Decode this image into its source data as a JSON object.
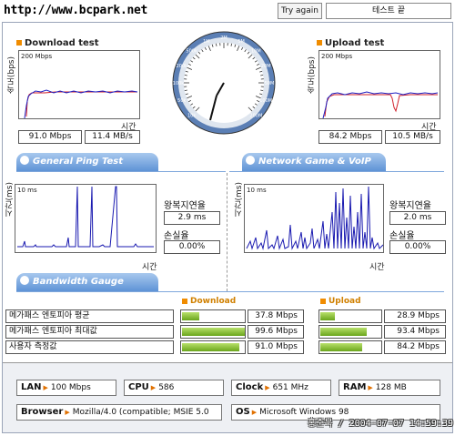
{
  "site": "http://www.bcpark.net",
  "top": {
    "try_again": "Try again",
    "status": "테스트 끝"
  },
  "download": {
    "title": "Download test",
    "ylabel": "속도(bps)",
    "tick": "200 Mbps",
    "xlabel": "시간",
    "value_mbps": "91.0 Mbps",
    "value_mbs": "11.4 MB/s"
  },
  "upload": {
    "title": "Upload test",
    "ylabel": "속도(bps)",
    "tick": "200 Mbps",
    "xlabel": "시간",
    "value_mbps": "84.2 Mbps",
    "value_mbs": "10.5 MB/s"
  },
  "gauge": {
    "labels": [
      "10k",
      "50k",
      "100k",
      "200k",
      "500k",
      "1M",
      "2M",
      "5M",
      "10M",
      "20M",
      "50M",
      "100M",
      "200M"
    ]
  },
  "general_ping": {
    "tab": "General Ping Test",
    "ylabel": "시간(ms)",
    "tick": "10 ms",
    "xlabel": "시간",
    "rtt_label": "왕복지연율",
    "rtt_value": "2.9 ms",
    "loss_label": "손실율",
    "loss_value": "0.00%"
  },
  "game_ping": {
    "tab": "Network Game & VoIP Test",
    "ylabel": "시간(ms)",
    "tick": "10 ms",
    "xlabel": "시간",
    "rtt_label": "왕복지연율",
    "rtt_value": "2.0 ms",
    "loss_label": "손실율",
    "loss_value": "0.00%"
  },
  "bandwidth": {
    "tab": "Bandwidth Gauge",
    "download_head": "Download",
    "upload_head": "Upload",
    "rows": [
      {
        "label": "메가패스 엔토피아 평균",
        "down": "37.8 Mbps",
        "down_frac": 0.28,
        "up": "28.9 Mbps",
        "up_frac": 0.31
      },
      {
        "label": "메가패스 엔토피아 최대값",
        "down": "99.6 Mbps",
        "down_frac": 1.0,
        "up": "93.4 Mbps",
        "up_frac": 1.0
      },
      {
        "label": "사용자 측정값",
        "down": "91.0 Mbps",
        "down_frac": 0.91,
        "up": "84.2 Mbps",
        "up_frac": 0.9
      }
    ]
  },
  "system": {
    "lan_k": "LAN",
    "lan_v": "100 Mbps",
    "cpu_k": "CPU",
    "cpu_v": "586",
    "clock_k": "Clock",
    "clock_v": "651 MHz",
    "ram_k": "RAM",
    "ram_v": "128 MB",
    "browser_k": "Browser",
    "browser_v": "Mozilla/4.0 (compatible; MSIE 5.0",
    "os_k": "OS",
    "os_v": "Microsoft Windows 98"
  },
  "watermark": "홍준묵 / 2004-07-07 14:59:39",
  "colors": {
    "accent": "#f08c00",
    "tab_blue": "#5e93d6",
    "bar_green": "#7ab82a",
    "ping_line": "#1a1ab0"
  }
}
